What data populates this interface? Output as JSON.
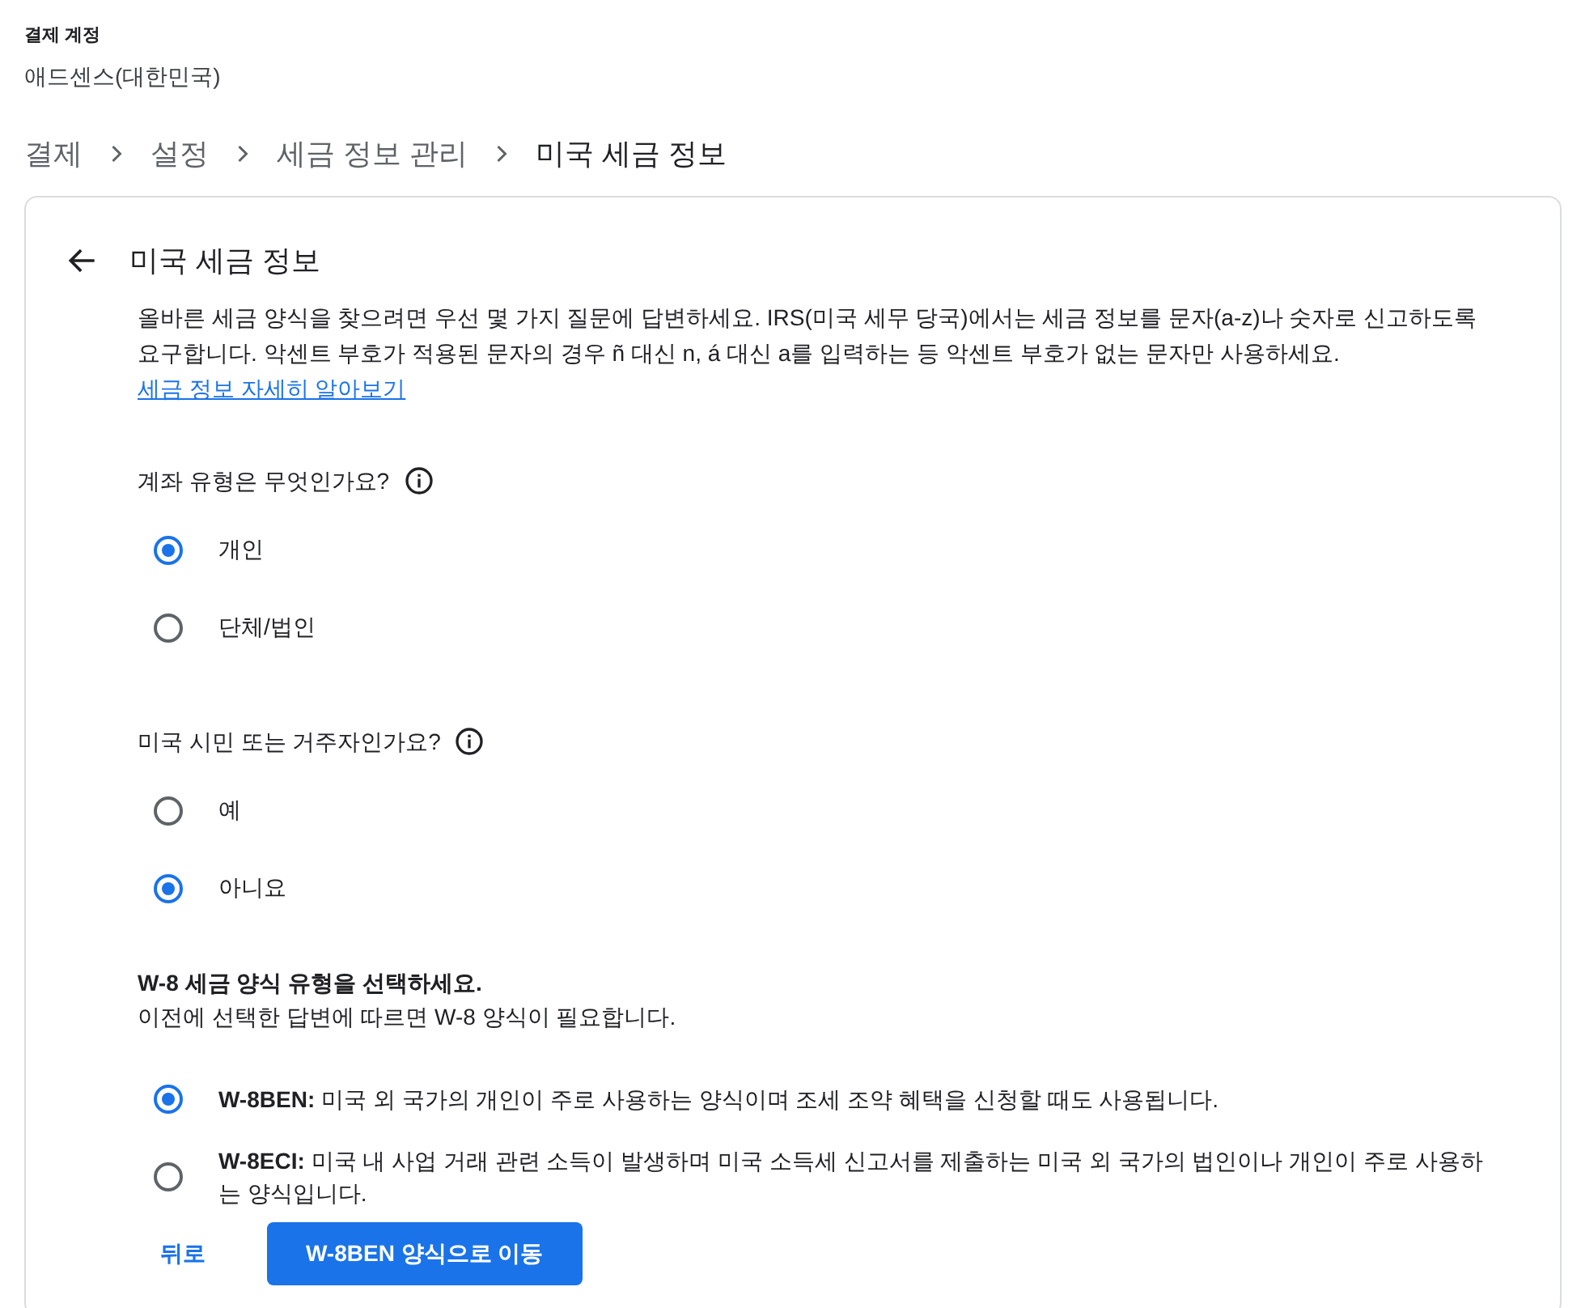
{
  "account": {
    "label": "결제 계정",
    "name": "애드센스(대한민국)"
  },
  "breadcrumb": [
    {
      "text": "결제",
      "current": false
    },
    {
      "text": "설정",
      "current": false
    },
    {
      "text": "세금 정보 관리",
      "current": false
    },
    {
      "text": "미국 세금 정보",
      "current": true
    }
  ],
  "card": {
    "title": "미국 세금 정보",
    "intro": "올바른 세금 양식을 찾으려면 우선 몇 가지 질문에 답변하세요. IRS(미국 세무 당국)에서는 세금 정보를 문자(a-z)나 숫자로 신고하도록 요구합니다. 악센트 부호가 적용된 문자의 경우 ñ 대신 n, á 대신 a를 입력하는 등 악센트 부호가 없는 문자만 사용하세요.",
    "learn_more_link": "세금 정보 자세히 알아보기",
    "questions": [
      {
        "question": "계좌 유형은 무엇인가요?",
        "options": [
          {
            "label": "개인",
            "selected": true
          },
          {
            "label": "단체/법인",
            "selected": false
          }
        ]
      },
      {
        "question": "미국 시민 또는 거주자인가요?",
        "options": [
          {
            "label": "예",
            "selected": false
          },
          {
            "label": "아니요",
            "selected": true
          }
        ]
      }
    ],
    "form_type": {
      "heading": "W-8 세금 양식 유형을 선택하세요.",
      "subtext": "이전에 선택한 답변에 따르면 W-8 양식이 필요합니다.",
      "options": [
        {
          "code": "W-8BEN:",
          "description": "미국 외 국가의 개인이 주로 사용하는 양식이며 조세 조약 혜택을 신청할 때도 사용됩니다.",
          "selected": true
        },
        {
          "code": "W-8ECI:",
          "description": "미국 내 사업 거래 관련 소득이 발생하며 미국 소득세 신고서를 제출하는 미국 외 국가의 법인이나 개인이 주로 사용하는 양식입니다.",
          "selected": false
        }
      ]
    },
    "back_button": "뒤로",
    "next_button": "W-8BEN 양식으로 이동"
  }
}
